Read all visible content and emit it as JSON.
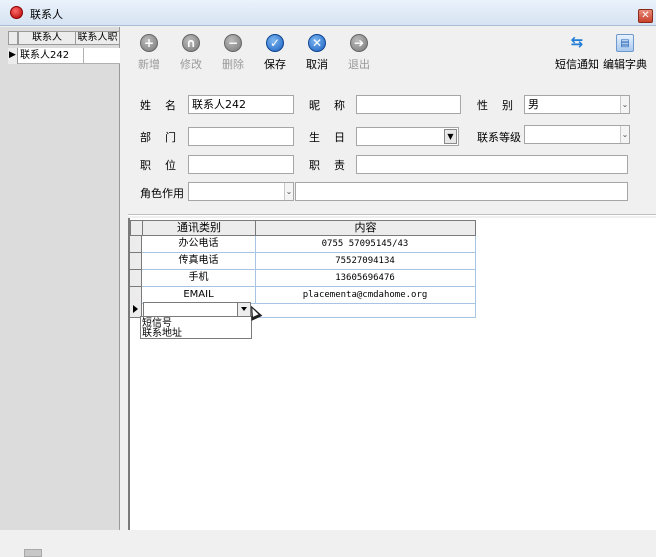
{
  "window": {
    "title": "联系人",
    "close_glyph": "✕"
  },
  "contact_list": {
    "columns": [
      "联系人",
      "联系人职"
    ],
    "rows": [
      {
        "name": "联系人242",
        "position": ""
      }
    ],
    "current_row_indicator": "▶"
  },
  "toolbar": {
    "add": {
      "label": "新增",
      "icon": "plus-icon",
      "enabled": false,
      "glyph": "+"
    },
    "edit": {
      "label": "修改",
      "icon": "edit-icon",
      "enabled": false,
      "glyph": "∩"
    },
    "delete": {
      "label": "删除",
      "icon": "minus-icon",
      "enabled": false,
      "glyph": "−"
    },
    "save": {
      "label": "保存",
      "icon": "check-icon",
      "enabled": true,
      "glyph": "✓"
    },
    "cancel": {
      "label": "取消",
      "icon": "x-icon",
      "enabled": true,
      "glyph": "✕"
    },
    "exit": {
      "label": "退出",
      "icon": "exit-icon",
      "enabled": false,
      "glyph": "➔"
    },
    "sms": {
      "label": "短信通知",
      "icon": "swap-arrows-icon",
      "glyph": "⇆"
    },
    "dictionary": {
      "label": "编辑字典",
      "icon": "book-icon",
      "glyph": "▤"
    }
  },
  "form": {
    "name": {
      "label": "姓    名",
      "value": "联系人242"
    },
    "nickname": {
      "label": "昵    称",
      "value": ""
    },
    "gender": {
      "label": "性    别",
      "value": "男"
    },
    "department": {
      "label": "部    门",
      "value": ""
    },
    "birthday": {
      "label": "生    日",
      "value": ""
    },
    "level": {
      "label": "联系等级",
      "value": ""
    },
    "title": {
      "label": "职    位",
      "value": ""
    },
    "duty": {
      "label": "职    责",
      "value": ""
    },
    "role": {
      "label": "角色作用",
      "value": "",
      "extra": ""
    },
    "dropdown_glyph": "▼",
    "narrow_dropdown_glyph": "⌄"
  },
  "comm_grid": {
    "columns": [
      "通讯类别",
      "内容"
    ],
    "rows": [
      {
        "type": "办公电话",
        "content": "0755 57095145/43"
      },
      {
        "type": "传真电话",
        "content": "75527094134"
      },
      {
        "type": "手机",
        "content": "13605696476"
      },
      {
        "type": "EMAIL",
        "content": "placementa@cmdahome.org"
      }
    ],
    "editing_value": "",
    "dropdown_options": [
      "短信号",
      "联系地址"
    ]
  },
  "colors": {
    "accent": "#1a5fc0",
    "grid_line": "#a7c4e3"
  }
}
